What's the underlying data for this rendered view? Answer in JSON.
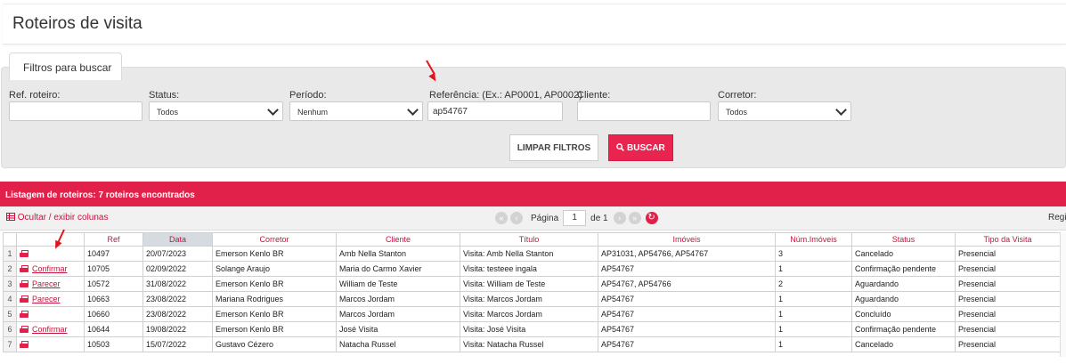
{
  "page": {
    "title": "Roteiros de visita"
  },
  "filters": {
    "tab_label": "Filtros para buscar",
    "ref_label": "Ref. roteiro:",
    "ref_value": "",
    "status_label": "Status:",
    "status_value": "Todos",
    "periodo_label": "Período:",
    "periodo_value": "Nenhum",
    "referencia_label": "Referência: (Ex.: AP0001, AP0002)",
    "referencia_value": "ap54767",
    "cliente_label": "Cliente:",
    "cliente_value": "",
    "corretor_label": "Corretor:",
    "corretor_value": "Todos",
    "clear_label": "LIMPAR FILTROS",
    "search_label": "BUSCAR",
    "search_icon": "search-icon"
  },
  "listing": {
    "header": "Listagem de roteiros: 7 roteiros encontrados",
    "toggle_columns": "Ocultar / exibir colunas",
    "page_label": "Página",
    "page_value": "1",
    "page_of": "de 1",
    "regi": "Regi"
  },
  "table": {
    "columns": [
      "Ref",
      "Data",
      "Corretor",
      "Cliente",
      "Título",
      "Imóveis",
      "Núm.Imóveis",
      "Status",
      "Tipo da Visita"
    ],
    "rows": [
      {
        "n": "1",
        "action": "",
        "ref": "10497",
        "data": "20/07/2023",
        "corretor": "Emerson Kenlo BR",
        "cliente": "Amb Nella Stanton",
        "titulo": "Visita: Amb Nella Stanton",
        "imoveis": "AP31031, AP54766, AP54767",
        "num": "3",
        "status": "Cancelado",
        "tipo": "Presencial"
      },
      {
        "n": "2",
        "action": "Confirmar",
        "ref": "10705",
        "data": "02/09/2022",
        "corretor": "Solange Araujo",
        "cliente": "Maria do Carmo Xavier",
        "titulo": "Visita: testeee ingala",
        "imoveis": "AP54767",
        "num": "1",
        "status": "Confirmação pendente",
        "tipo": "Presencial"
      },
      {
        "n": "3",
        "action": "Parecer",
        "ref": "10572",
        "data": "31/08/2022",
        "corretor": "Emerson Kenlo BR",
        "cliente": "William de Teste",
        "titulo": "Visita: William de Teste",
        "imoveis": "AP54767, AP54766",
        "num": "2",
        "status": "Aguardando",
        "tipo": "Presencial"
      },
      {
        "n": "4",
        "action": "Parecer",
        "ref": "10663",
        "data": "23/08/2022",
        "corretor": "Mariana Rodrigues",
        "cliente": "Marcos Jordam",
        "titulo": "Visita: Marcos Jordam",
        "imoveis": "AP54767",
        "num": "1",
        "status": "Aguardando",
        "tipo": "Presencial"
      },
      {
        "n": "5",
        "action": "",
        "ref": "10660",
        "data": "23/08/2022",
        "corretor": "Emerson Kenlo BR",
        "cliente": "Marcos Jordam",
        "titulo": "Visita: Marcos Jordam",
        "imoveis": "AP54767",
        "num": "1",
        "status": "Concluído",
        "tipo": "Presencial"
      },
      {
        "n": "6",
        "action": "Confirmar",
        "ref": "10644",
        "data": "19/08/2022",
        "corretor": "Emerson Kenlo BR",
        "cliente": "José Visita",
        "titulo": "Visita: José Visita",
        "imoveis": "AP54767",
        "num": "1",
        "status": "Confirmação pendente",
        "tipo": "Presencial"
      },
      {
        "n": "7",
        "action": "",
        "ref": "10503",
        "data": "15/07/2022",
        "corretor": "Gustavo Cézero",
        "cliente": "Natacha Russel",
        "titulo": "Visita: Natacha Russel",
        "imoveis": "AP54767",
        "num": "1",
        "status": "Cancelado",
        "tipo": "Presencial"
      }
    ]
  },
  "colors": {
    "accent": "#e1214a",
    "link": "#c4143c",
    "annotation_arrow": "#e3141e"
  }
}
